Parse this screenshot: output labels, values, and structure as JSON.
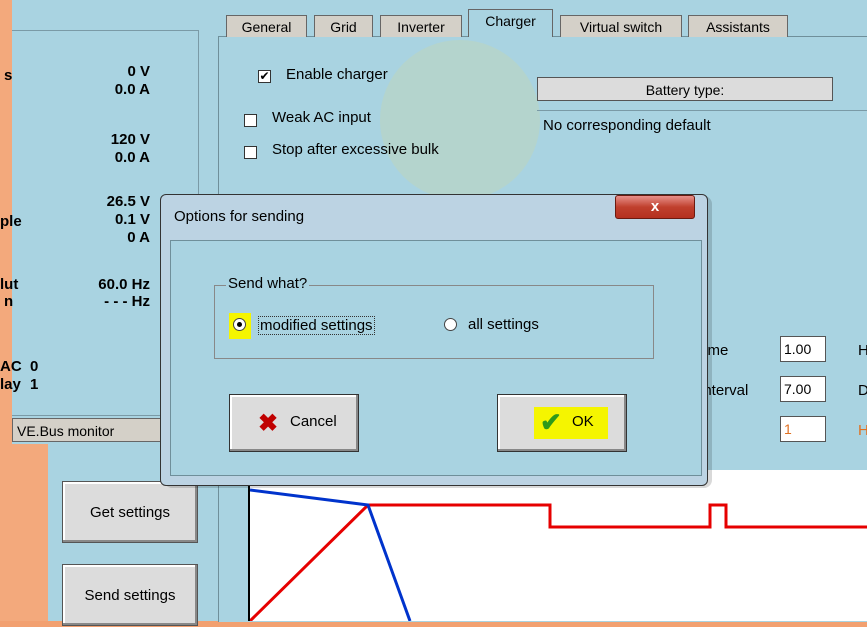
{
  "left_panel": {
    "readings": [
      {
        "label": "s",
        "value": "0 V"
      },
      {
        "label": "",
        "value": "0.0 A"
      },
      {
        "label": "",
        "value": "120 V"
      },
      {
        "label": "",
        "value": "0.0 A"
      },
      {
        "label": "",
        "value": "26.5 V"
      },
      {
        "label": "ple",
        "value": "0.1 V"
      },
      {
        "label": "",
        "value": "0 A"
      },
      {
        "label": "lut",
        "value": "60.0 Hz"
      },
      {
        "label": "n",
        "value": "- - - Hz"
      },
      {
        "label": "AC",
        "value": "0"
      },
      {
        "label": "lay",
        "value": "1"
      }
    ],
    "vebus_monitor": "VE.Bus monitor",
    "get_settings": "Get settings",
    "send_settings": "Send settings"
  },
  "tabs": [
    "General",
    "Grid",
    "Inverter",
    "Charger",
    "Virtual switch",
    "Assistants"
  ],
  "active_tab": "Charger",
  "charger": {
    "enable_charger": {
      "label": "Enable charger",
      "checked": true
    },
    "weak_ac": {
      "label": "Weak AC input",
      "checked": false
    },
    "stop_bulk": {
      "label": "Stop after excessive bulk",
      "checked": false
    },
    "battery_type_button": "Battery type:",
    "battery_type_text": "No corresponding default",
    "fields": [
      {
        "label": "time",
        "value": "1.00",
        "unit": "H"
      },
      {
        "label": "interval",
        "value": "7.00",
        "unit": "D"
      },
      {
        "label": "",
        "value": "1",
        "unit": "H"
      }
    ]
  },
  "dialog": {
    "title": "Options for sending",
    "close_glyph": "x",
    "group_title": "Send what?",
    "options": [
      {
        "label": "modified settings",
        "selected": true
      },
      {
        "label": "all settings",
        "selected": false
      }
    ],
    "cancel_label": "Cancel",
    "ok_label": "OK"
  },
  "colors": {
    "panel_blue": "#a9d3e1",
    "orange": "#f3a97c",
    "highlight": "#f5f500",
    "chart_red": "#e60000",
    "chart_blue": "#0033cc"
  }
}
